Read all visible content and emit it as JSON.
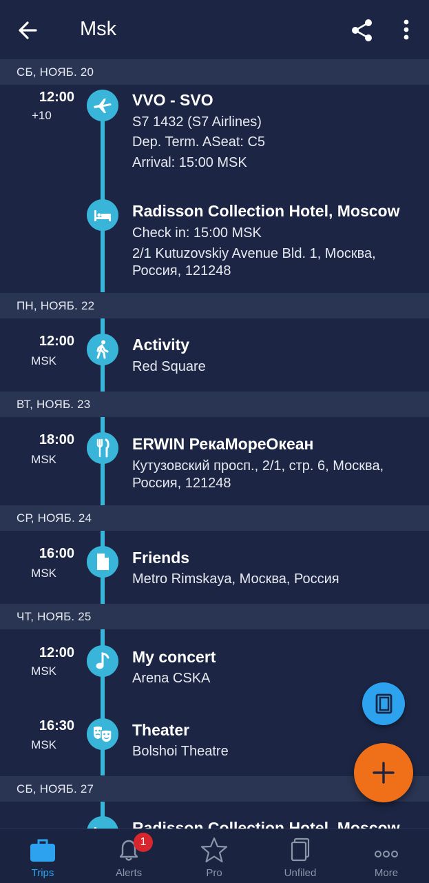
{
  "header": {
    "title": "Msk",
    "back_icon": "arrow-left-icon",
    "share_icon": "share-icon",
    "more_icon": "more-vert-icon"
  },
  "days": [
    {
      "label": "СБ, НОЯБ. 20",
      "events": [
        {
          "time": "12:00",
          "tz": "+10",
          "icon": "airplane-icon",
          "title": "VVO - SVO",
          "lines": [
            "S7 1432 (S7 Airlines)",
            "Dep. Term. ASeat: C5",
            "Arrival: 15:00 MSK"
          ]
        },
        {
          "time": "",
          "tz": "",
          "icon": "bed-icon",
          "title": "Radisson Collection Hotel, Moscow",
          "lines": [
            "Check in: 15:00 MSK",
            "2/1 Kutuzovskiy Avenue Bld. 1, Москва,",
            "Россия, 121248"
          ]
        }
      ]
    },
    {
      "label": "ПН, НОЯБ. 22",
      "events": [
        {
          "time": "12:00",
          "tz": "MSK",
          "icon": "walking-person-icon",
          "title": "Activity",
          "lines": [
            "Red Square"
          ]
        }
      ]
    },
    {
      "label": "ВТ, НОЯБ. 23",
      "events": [
        {
          "time": "18:00",
          "tz": "MSK",
          "icon": "fork-knife-icon",
          "title": "ERWIN РекаМореОкеан",
          "lines": [
            "Кутузовский просп., 2/1, стр. 6, Москва,",
            "Россия, 121248"
          ]
        }
      ]
    },
    {
      "label": "СР, НОЯБ. 24",
      "events": [
        {
          "time": "16:00",
          "tz": "MSK",
          "icon": "document-icon",
          "title": "Friends",
          "lines": [
            "Metro Rimskaya, Москва, Россия"
          ]
        }
      ]
    },
    {
      "label": "ЧТ, НОЯБ. 25",
      "events": [
        {
          "time": "12:00",
          "tz": "MSK",
          "icon": "music-note-icon",
          "title": "My concert",
          "lines": [
            "Arena CSKA"
          ]
        },
        {
          "time": "16:30",
          "tz": "MSK",
          "icon": "theater-masks-icon",
          "title": "Theater",
          "lines": [
            "Bolshoi Theatre"
          ]
        }
      ]
    },
    {
      "label": "СБ, НОЯБ. 27",
      "events": [
        {
          "time": "",
          "tz": "",
          "icon": "bed-icon",
          "title": "Radisson Collection Hotel, Moscow",
          "lines": []
        }
      ]
    }
  ],
  "fab": {
    "notebook_icon": "notebook-icon",
    "add_icon": "plus-icon"
  },
  "nav": {
    "items": [
      {
        "label": "Trips",
        "icon": "briefcase-icon",
        "active": true
      },
      {
        "label": "Alerts",
        "icon": "bell-icon",
        "badge": "1"
      },
      {
        "label": "Pro",
        "icon": "star-icon"
      },
      {
        "label": "Unfiled",
        "icon": "documents-stack-icon"
      },
      {
        "label": "More",
        "icon": "three-dots-icon"
      }
    ]
  },
  "colors": {
    "background": "#1c2644",
    "day_header": "#2a3553",
    "timeline": "#38b5d8",
    "fab_orange": "#f0701a",
    "fab_blue": "#2da3f0",
    "active_tab": "#2da3f0",
    "badge": "#d8262e"
  }
}
